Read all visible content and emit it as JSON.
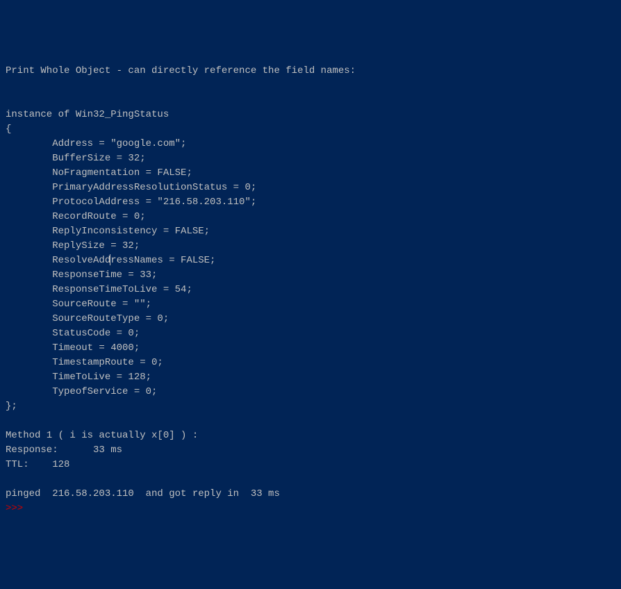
{
  "header": "Print Whole Object - can directly reference the field names:",
  "instance_line": "instance of Win32_PingStatus",
  "open_brace": "{",
  "fields": {
    "Address": "        Address = \"google.com\";",
    "BufferSize": "        BufferSize = 32;",
    "NoFragmentation": "        NoFragmentation = FALSE;",
    "PrimaryAddressResolutionStatus": "        PrimaryAddressResolutionStatus = 0;",
    "ProtocolAddress": "        ProtocolAddress = \"216.58.203.110\";",
    "RecordRoute": "        RecordRoute = 0;",
    "ReplyInconsistency": "        ReplyInconsistency = FALSE;",
    "ReplySize": "        ReplySize = 32;",
    "ResolveAddressNames_pre": "        ResolveAdd",
    "ResolveAddressNames_post": "ressNames = FALSE;",
    "ResponseTime": "        ResponseTime = 33;",
    "ResponseTimeToLive": "        ResponseTimeToLive = 54;",
    "SourceRoute": "        SourceRoute = \"\";",
    "SourceRouteType": "        SourceRouteType = 0;",
    "StatusCode": "        StatusCode = 0;",
    "Timeout": "        Timeout = 4000;",
    "TimestampRoute": "        TimestampRoute = 0;",
    "TimeToLive": "        TimeToLive = 128;",
    "TypeofService": "        TypeofService = 0;"
  },
  "close_brace": "};",
  "method_header": "Method 1 ( i is actually x[0] ) :",
  "response_line": "Response:      33 ms",
  "ttl_line": "TTL:    128",
  "pinged_line": "pinged  216.58.203.110  and got reply in  33 ms",
  "prompt": ">>> "
}
